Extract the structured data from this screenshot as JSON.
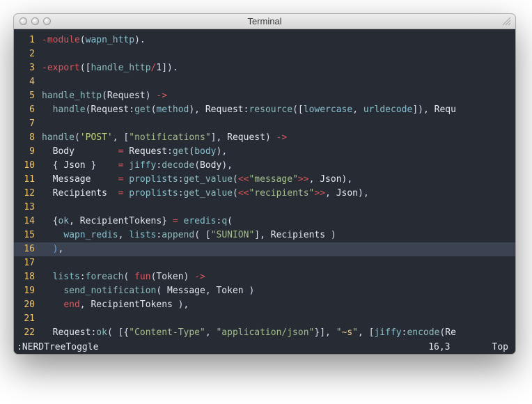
{
  "window": {
    "title": "Terminal"
  },
  "editor": {
    "lines": [
      {
        "n": 1,
        "cursor": false,
        "tokens": [
          [
            "red",
            "-module"
          ],
          [
            "def",
            "("
          ],
          [
            "cyan",
            "wapn_http"
          ],
          [
            "def",
            ")."
          ]
        ]
      },
      {
        "n": 2,
        "cursor": false,
        "tokens": []
      },
      {
        "n": 3,
        "cursor": false,
        "tokens": [
          [
            "red",
            "-export"
          ],
          [
            "def",
            "(["
          ],
          [
            "fn",
            "handle_http"
          ],
          [
            "red",
            "/"
          ],
          [
            "white",
            "1"
          ],
          [
            "def",
            "])."
          ]
        ]
      },
      {
        "n": 4,
        "cursor": false,
        "tokens": []
      },
      {
        "n": 5,
        "cursor": false,
        "tokens": [
          [
            "fn",
            "handle_http"
          ],
          [
            "def",
            "("
          ],
          [
            "white",
            "Request"
          ],
          [
            "def",
            ") "
          ],
          [
            "red",
            "->"
          ]
        ]
      },
      {
        "n": 6,
        "cursor": false,
        "tokens": [
          [
            "def",
            "  "
          ],
          [
            "fn",
            "handle"
          ],
          [
            "def",
            "("
          ],
          [
            "white",
            "Request"
          ],
          [
            "def",
            ":"
          ],
          [
            "fn",
            "get"
          ],
          [
            "def",
            "("
          ],
          [
            "cyan",
            "method"
          ],
          [
            "def",
            "), "
          ],
          [
            "white",
            "Request"
          ],
          [
            "def",
            ":"
          ],
          [
            "fn",
            "resource"
          ],
          [
            "def",
            "(["
          ],
          [
            "cyan",
            "lowercase"
          ],
          [
            "def",
            ", "
          ],
          [
            "cyan",
            "urldecode"
          ],
          [
            "def",
            "]), "
          ],
          [
            "white",
            "Requ"
          ]
        ]
      },
      {
        "n": 7,
        "cursor": false,
        "tokens": []
      },
      {
        "n": 8,
        "cursor": false,
        "tokens": [
          [
            "fn",
            "handle"
          ],
          [
            "def",
            "("
          ],
          [
            "yellow",
            "'POST'"
          ],
          [
            "def",
            ", ["
          ],
          [
            "lime",
            "\"notifications\""
          ],
          [
            "def",
            "], "
          ],
          [
            "white",
            "Request"
          ],
          [
            "def",
            ") "
          ],
          [
            "red",
            "->"
          ]
        ]
      },
      {
        "n": 9,
        "cursor": false,
        "tokens": [
          [
            "def",
            "  "
          ],
          [
            "white",
            "Body"
          ],
          [
            "def",
            "        "
          ],
          [
            "red",
            "="
          ],
          [
            "def",
            " "
          ],
          [
            "white",
            "Request"
          ],
          [
            "def",
            ":"
          ],
          [
            "fn",
            "get"
          ],
          [
            "def",
            "("
          ],
          [
            "cyan",
            "body"
          ],
          [
            "def",
            "),"
          ]
        ]
      },
      {
        "n": 10,
        "cursor": false,
        "tokens": [
          [
            "def",
            "  { "
          ],
          [
            "white",
            "Json"
          ],
          [
            "def",
            " }    "
          ],
          [
            "red",
            "="
          ],
          [
            "def",
            " "
          ],
          [
            "cyan",
            "jiffy"
          ],
          [
            "def",
            ":"
          ],
          [
            "fn",
            "decode"
          ],
          [
            "def",
            "("
          ],
          [
            "white",
            "Body"
          ],
          [
            "def",
            "),"
          ]
        ]
      },
      {
        "n": 11,
        "cursor": false,
        "tokens": [
          [
            "def",
            "  "
          ],
          [
            "white",
            "Message"
          ],
          [
            "def",
            "     "
          ],
          [
            "red",
            "="
          ],
          [
            "def",
            " "
          ],
          [
            "cyan",
            "proplists"
          ],
          [
            "def",
            ":"
          ],
          [
            "fn",
            "get_value"
          ],
          [
            "def",
            "("
          ],
          [
            "red",
            "<<"
          ],
          [
            "lime",
            "\"message\""
          ],
          [
            "red",
            ">>"
          ],
          [
            "def",
            ", "
          ],
          [
            "white",
            "Json"
          ],
          [
            "def",
            "),"
          ]
        ]
      },
      {
        "n": 12,
        "cursor": false,
        "tokens": [
          [
            "def",
            "  "
          ],
          [
            "white",
            "Recipients"
          ],
          [
            "def",
            "  "
          ],
          [
            "red",
            "="
          ],
          [
            "def",
            " "
          ],
          [
            "cyan",
            "proplists"
          ],
          [
            "def",
            ":"
          ],
          [
            "fn",
            "get_value"
          ],
          [
            "def",
            "("
          ],
          [
            "red",
            "<<"
          ],
          [
            "lime",
            "\"recipients\""
          ],
          [
            "red",
            ">>"
          ],
          [
            "def",
            ", "
          ],
          [
            "white",
            "Json"
          ],
          [
            "def",
            "),"
          ]
        ]
      },
      {
        "n": 13,
        "cursor": false,
        "tokens": []
      },
      {
        "n": 14,
        "cursor": false,
        "tokens": [
          [
            "def",
            "  {"
          ],
          [
            "cyan",
            "ok"
          ],
          [
            "def",
            ", "
          ],
          [
            "white",
            "RecipientTokens"
          ],
          [
            "def",
            "} "
          ],
          [
            "red",
            "="
          ],
          [
            "def",
            " "
          ],
          [
            "cyan",
            "eredis"
          ],
          [
            "def",
            ":"
          ],
          [
            "fn",
            "q"
          ],
          [
            "def",
            "("
          ]
        ]
      },
      {
        "n": 15,
        "cursor": false,
        "tokens": [
          [
            "def",
            "    "
          ],
          [
            "cyan",
            "wapn_redis"
          ],
          [
            "def",
            ", "
          ],
          [
            "cyan",
            "lists"
          ],
          [
            "def",
            ":"
          ],
          [
            "fn",
            "append"
          ],
          [
            "def",
            "( ["
          ],
          [
            "lime",
            "\"SUNION\""
          ],
          [
            "def",
            "], "
          ],
          [
            "white",
            "Recipients"
          ],
          [
            "def",
            " )"
          ]
        ]
      },
      {
        "n": 16,
        "cursor": true,
        "tokens": [
          [
            "def",
            "  "
          ],
          [
            "blue",
            ")"
          ],
          [
            "def",
            ","
          ]
        ]
      },
      {
        "n": 17,
        "cursor": false,
        "tokens": []
      },
      {
        "n": 18,
        "cursor": false,
        "tokens": [
          [
            "def",
            "  "
          ],
          [
            "cyan",
            "lists"
          ],
          [
            "def",
            ":"
          ],
          [
            "fn",
            "foreach"
          ],
          [
            "def",
            "( "
          ],
          [
            "red",
            "fun"
          ],
          [
            "def",
            "("
          ],
          [
            "white",
            "Token"
          ],
          [
            "def",
            ") "
          ],
          [
            "red",
            "->"
          ]
        ]
      },
      {
        "n": 19,
        "cursor": false,
        "tokens": [
          [
            "def",
            "    "
          ],
          [
            "fn",
            "send_notification"
          ],
          [
            "def",
            "( "
          ],
          [
            "white",
            "Message"
          ],
          [
            "def",
            ", "
          ],
          [
            "white",
            "Token"
          ],
          [
            "def",
            " )"
          ]
        ]
      },
      {
        "n": 20,
        "cursor": false,
        "tokens": [
          [
            "def",
            "    "
          ],
          [
            "red",
            "end"
          ],
          [
            "def",
            ", "
          ],
          [
            "white",
            "RecipientTokens"
          ],
          [
            "def",
            " ),"
          ]
        ]
      },
      {
        "n": 21,
        "cursor": false,
        "tokens": []
      },
      {
        "n": 22,
        "cursor": false,
        "tokens": [
          [
            "def",
            "  "
          ],
          [
            "white",
            "Request"
          ],
          [
            "def",
            ":"
          ],
          [
            "fn",
            "ok"
          ],
          [
            "def",
            "( [{"
          ],
          [
            "lime",
            "\"Content-Type\""
          ],
          [
            "def",
            ", "
          ],
          [
            "lime",
            "\"application/json\""
          ],
          [
            "def",
            "}], "
          ],
          [
            "lime",
            "\""
          ],
          [
            "gold",
            "~s"
          ],
          [
            "lime",
            "\""
          ],
          [
            "def",
            ", ["
          ],
          [
            "cyan",
            "jiffy"
          ],
          [
            "def",
            ":"
          ],
          [
            "fn",
            "encode"
          ],
          [
            "def",
            "("
          ],
          [
            "white",
            "Re"
          ]
        ]
      }
    ]
  },
  "statusbar": {
    "left": ":NERDTreeToggle",
    "pos": "16,3",
    "right": "Top"
  }
}
